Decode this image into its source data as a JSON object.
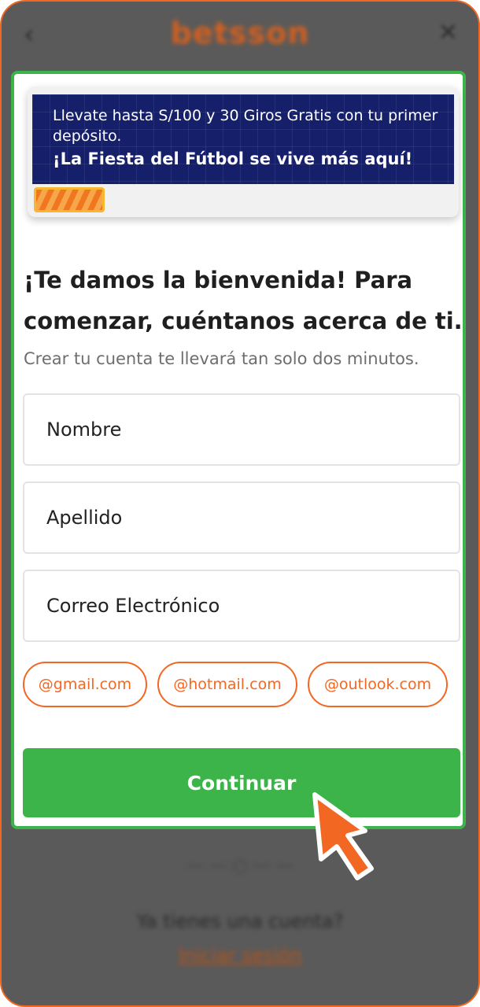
{
  "background": {
    "brand_logo": "betsson",
    "back_icon": "chevron-left-icon",
    "close_icon": "close-icon",
    "have_account_text": "Ya tienes una cuenta?",
    "login_link": "Iniciar sesión"
  },
  "promo": {
    "text": "Llevate hasta S/100 y 30 Giros Gratis con tu primer depósito.",
    "headline": "¡La Fiesta del Fútbol se vive más aquí!",
    "progress_fraction": 0.15
  },
  "form": {
    "title": "¡Te damos la bienvenida! Para comenzar, cuéntanos acerca de ti.",
    "subtitle": "Crear tu cuenta te llevará tan solo dos minutos.",
    "first_name_placeholder": "Nombre",
    "last_name_placeholder": "Apellido",
    "email_placeholder": "Correo Electrónico",
    "email_domains": [
      "@gmail.com",
      "@hotmail.com",
      "@outlook.com"
    ],
    "continue_label": "Continuar"
  },
  "colors": {
    "brand_orange": "#f26722",
    "accent_green": "#3cb44a",
    "promo_navy": "#16206a"
  }
}
